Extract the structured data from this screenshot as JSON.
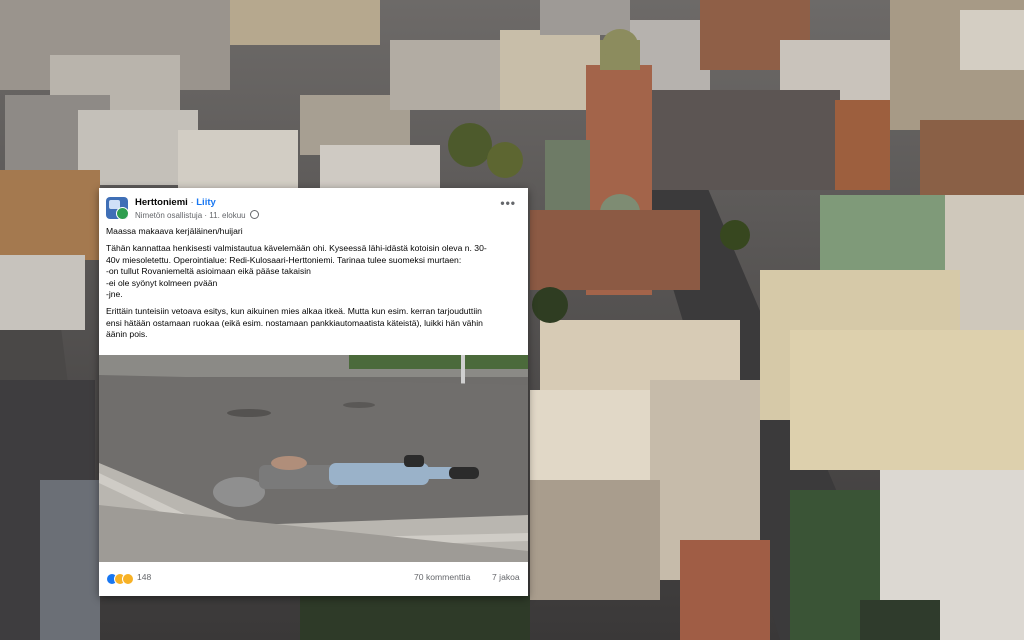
{
  "post": {
    "group_name": "Herttoniemi",
    "separator": "·",
    "join_label": "Liity",
    "author": "Nimetön osallistuja",
    "date": "11. elokuu",
    "more_label": "•••",
    "title": "Maassa makaava kerjäläinen/huijari",
    "para1_lines": [
      "Tähän kannattaa henkisesti valmistautua kävelemään ohi. Kyseessä lähi-idästä kotoisin oleva n. 30-",
      "40v miesoletettu. Operointialue: Redi-Kulosaari-Herttoniemi. Tarinaa tulee suomeksi murtaen:",
      "-on tullut Rovaniemeltä asioimaan eikä pääse takaisin",
      "-ei ole syönyt kolmeen pvään",
      "-jne."
    ],
    "para2_lines": [
      "Erittäin tunteisiin vetoava esitys, kun aikuinen mies alkaa itkeä. Mutta kun esim. kerran tarjouduttiin",
      "ensi hätään ostamaan ruokaa (eikä esim. nostamaan pankkiautomaatista käteistä), luikki hän vähin",
      "äänin pois."
    ],
    "reaction_count": "148",
    "comments": "70 kommenttia",
    "shares": "7 jakoa"
  },
  "icons": [
    "group-avatar-icon",
    "globe-icon",
    "like-reaction-icon",
    "haha-reaction-icon",
    "wow-reaction-icon"
  ],
  "colors": {
    "link": "#1877f2",
    "muted": "#65676b",
    "text": "#050505"
  }
}
